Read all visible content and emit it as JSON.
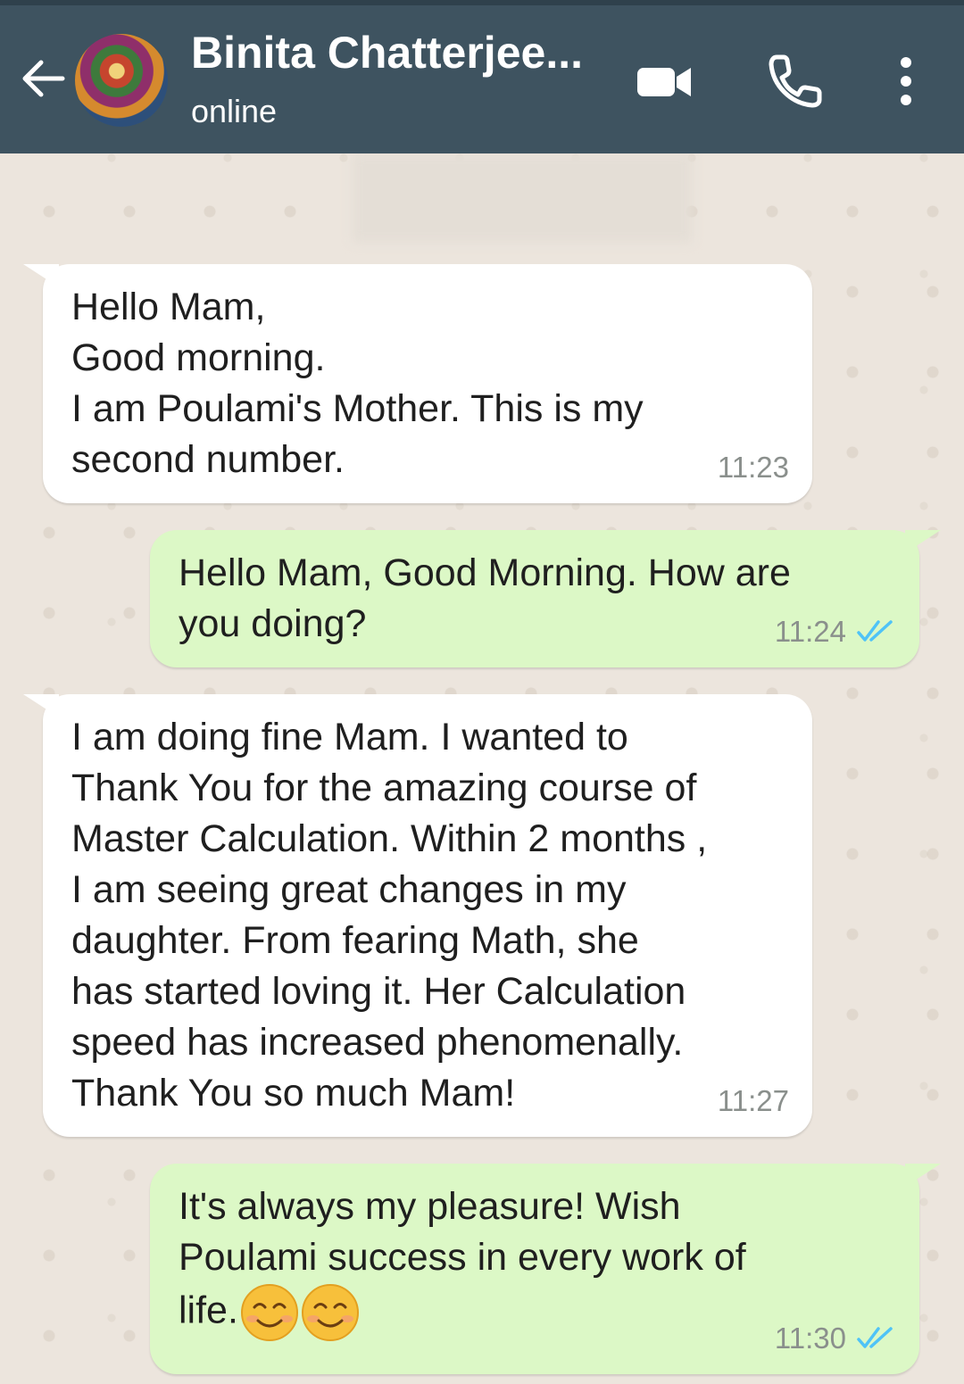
{
  "header": {
    "contact_name": "Binita Chatterjee...",
    "status": "online",
    "back_icon": "arrow-left-icon",
    "video_icon": "video-camera-icon",
    "call_icon": "phone-icon",
    "menu_icon": "more-vertical-icon",
    "bg_color": "#3e5360"
  },
  "messages": [
    {
      "direction": "incoming",
      "text": "Hello Mam,\nGood morning.\nI am Poulami's Mother. This is my\nsecond number.",
      "time": "11:23"
    },
    {
      "direction": "outgoing",
      "text": "Hello Mam, Good Morning. How are\nyou doing?",
      "time": "11:24",
      "read": true
    },
    {
      "direction": "incoming",
      "text": "I am doing fine Mam. I wanted to\nThank You for the amazing course of\nMaster Calculation. Within 2 months ,\nI am seeing great changes in my\ndaughter. From fearing Math, she\nhas started loving it. Her Calculation\nspeed has increased phenomenally.\nThank You so much Mam!",
      "time": "11:27"
    },
    {
      "direction": "outgoing",
      "text": "It's always my pleasure! Wish\nPoulami success in every work of\nlife.",
      "emoji": [
        "smiling-face-icon",
        "smiling-face-icon"
      ],
      "time": "11:30",
      "read": true
    }
  ],
  "colors": {
    "incoming_bubble": "#ffffff",
    "outgoing_bubble": "#dcf8c6",
    "read_ticks": "#4fc3f7",
    "chat_bg": "#ece5dd"
  }
}
